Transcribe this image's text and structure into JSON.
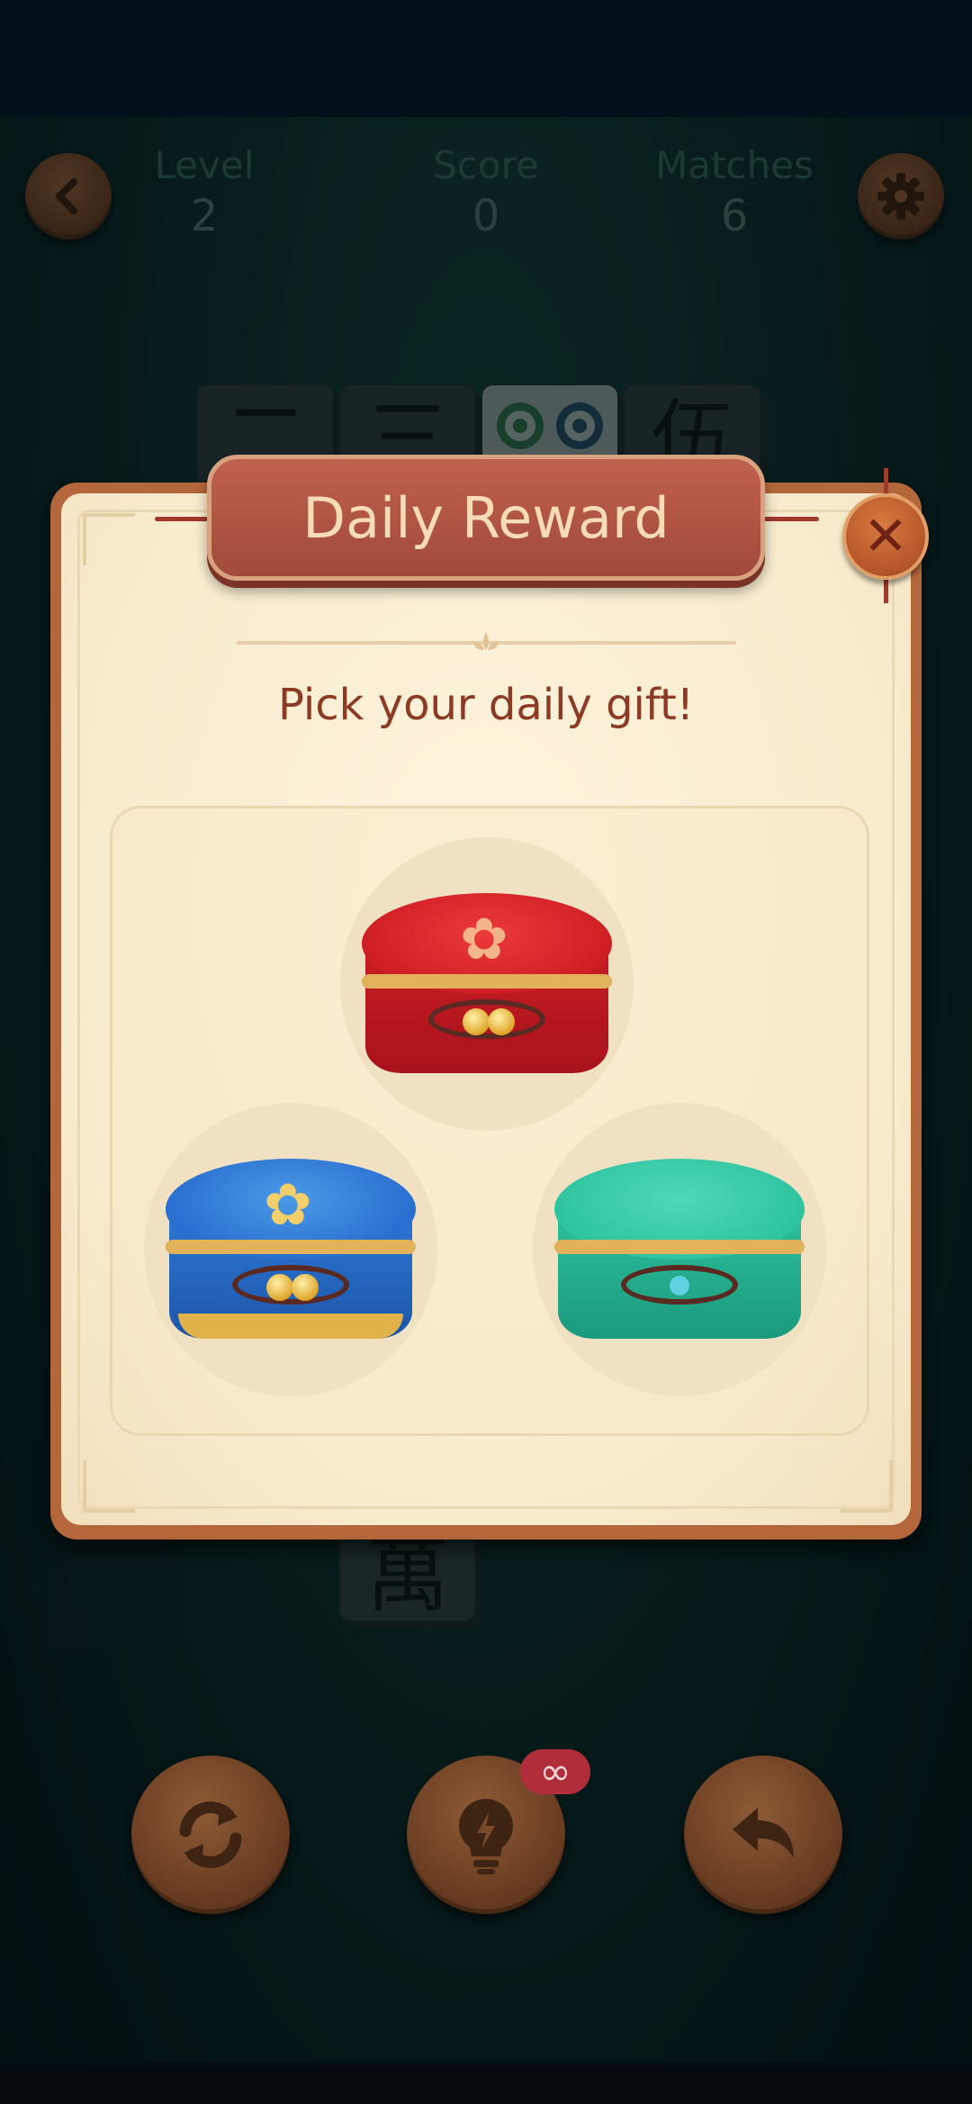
{
  "header": {
    "back_icon": "chevron-left-icon",
    "settings_icon": "gear-icon",
    "stats": [
      {
        "label": "Level",
        "value": "2"
      },
      {
        "label": "Score",
        "value": "0"
      },
      {
        "label": "Matches",
        "value": "6"
      }
    ]
  },
  "board": {
    "top_tiles": [
      "二",
      "三",
      "◎◎",
      "伍"
    ],
    "bottom_tile": "萬"
  },
  "dialog": {
    "title": "Daily Reward",
    "close_label": "✕",
    "subtitle": "Pick your daily gift!",
    "gifts": [
      {
        "name": "red-gift-box",
        "color": "#d8242a"
      },
      {
        "name": "blue-gift-box",
        "color": "#2a6fd0"
      },
      {
        "name": "green-gift-box",
        "color": "#2fc4a0"
      }
    ]
  },
  "tools": {
    "shuffle_icon": "shuffle-icon",
    "hint_icon": "lightbulb-icon",
    "hint_badge": "∞",
    "undo_icon": "undo-icon"
  },
  "colors": {
    "wood": "#6b3e22",
    "dialog_border": "#b4673a",
    "parchment": "#f8ebcd",
    "banner": "#a24a3c",
    "title_text": "#f8dcb8",
    "subtitle_text": "#8c3a24"
  }
}
